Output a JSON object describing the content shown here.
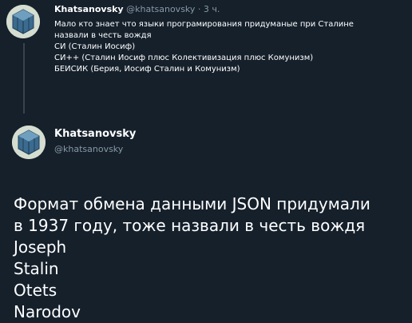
{
  "reply_tweet": {
    "author_name": "Khatsanovsky",
    "handle": "@khatsanovsky",
    "separator": "·",
    "time": "3 ч.",
    "lines": [
      "Мало кто знает что языки програмирования придуманые при Сталине",
      "назвали в честь вождя",
      "СИ  (Сталин Иосиф)",
      "СИ++ (Сталин Иосиф плюс Колективизация плюс Комунизм)",
      "БЕИСИК (Берия, Иосиф Сталин и Комунизм)"
    ]
  },
  "main_tweet": {
    "author_name": "Khatsanovsky",
    "handle": "@khatsanovsky",
    "lines": [
      "Формат обмена данными JSON придумали",
      "в 1937 году, тоже назвали в честь вождя",
      "Joseph",
      "Stalin",
      "Otets",
      "Narodov"
    ]
  },
  "colors": {
    "background": "#15202b",
    "text": "#ffffff",
    "muted": "#8899a6",
    "thread_line": "#38444d"
  }
}
